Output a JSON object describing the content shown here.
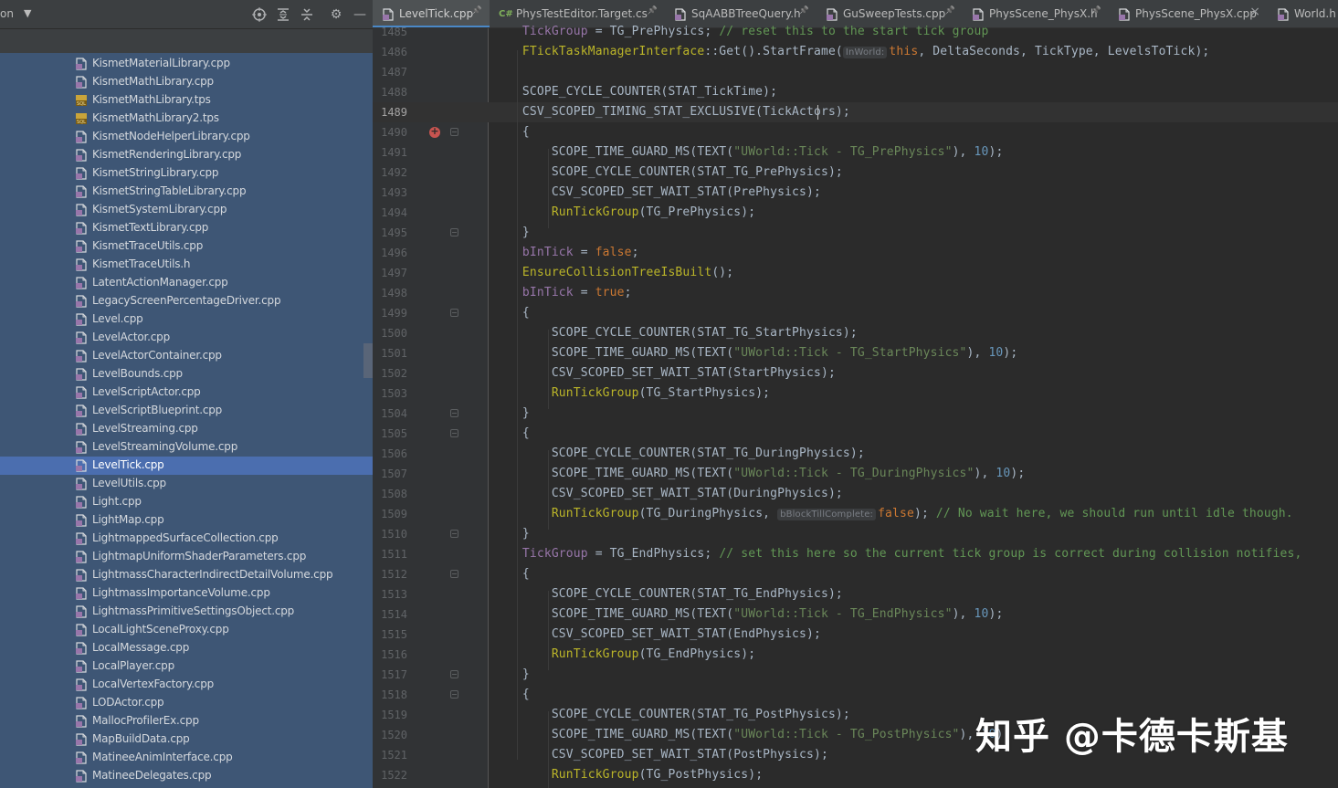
{
  "project_panel": {
    "title": "on",
    "dropdown_icon": "triangle-down-icon",
    "toolbar_icons": [
      "locate-icon",
      "expand-all-icon",
      "collapse-all-icon",
      "gear-icon",
      "minimize-icon"
    ],
    "files": [
      {
        "name": "KismetMaterialLibrary.cpp",
        "icon": "cpp-file-icon"
      },
      {
        "name": "KismetMathLibrary.cpp",
        "icon": "cpp-file-icon"
      },
      {
        "name": "KismetMathLibrary.tps",
        "icon": "sql-file-icon"
      },
      {
        "name": "KismetMathLibrary2.tps",
        "icon": "sql-file-icon"
      },
      {
        "name": "KismetNodeHelperLibrary.cpp",
        "icon": "cpp-file-icon"
      },
      {
        "name": "KismetRenderingLibrary.cpp",
        "icon": "cpp-file-icon"
      },
      {
        "name": "KismetStringLibrary.cpp",
        "icon": "cpp-file-icon"
      },
      {
        "name": "KismetStringTableLibrary.cpp",
        "icon": "cpp-file-icon"
      },
      {
        "name": "KismetSystemLibrary.cpp",
        "icon": "cpp-file-icon"
      },
      {
        "name": "KismetTextLibrary.cpp",
        "icon": "cpp-file-icon"
      },
      {
        "name": "KismetTraceUtils.cpp",
        "icon": "cpp-file-icon"
      },
      {
        "name": "KismetTraceUtils.h",
        "icon": "h-file-icon"
      },
      {
        "name": "LatentActionManager.cpp",
        "icon": "cpp-file-icon"
      },
      {
        "name": "LegacyScreenPercentageDriver.cpp",
        "icon": "cpp-file-icon"
      },
      {
        "name": "Level.cpp",
        "icon": "cpp-file-icon"
      },
      {
        "name": "LevelActor.cpp",
        "icon": "cpp-file-icon"
      },
      {
        "name": "LevelActorContainer.cpp",
        "icon": "cpp-file-icon"
      },
      {
        "name": "LevelBounds.cpp",
        "icon": "cpp-file-icon"
      },
      {
        "name": "LevelScriptActor.cpp",
        "icon": "cpp-file-icon"
      },
      {
        "name": "LevelScriptBlueprint.cpp",
        "icon": "cpp-file-icon"
      },
      {
        "name": "LevelStreaming.cpp",
        "icon": "cpp-file-icon"
      },
      {
        "name": "LevelStreamingVolume.cpp",
        "icon": "cpp-file-icon"
      },
      {
        "name": "LevelTick.cpp",
        "icon": "cpp-file-icon",
        "selected": true
      },
      {
        "name": "LevelUtils.cpp",
        "icon": "cpp-file-icon"
      },
      {
        "name": "Light.cpp",
        "icon": "cpp-file-icon"
      },
      {
        "name": "LightMap.cpp",
        "icon": "cpp-file-icon"
      },
      {
        "name": "LightmappedSurfaceCollection.cpp",
        "icon": "cpp-file-icon"
      },
      {
        "name": "LightmapUniformShaderParameters.cpp",
        "icon": "cpp-file-icon"
      },
      {
        "name": "LightmassCharacterIndirectDetailVolume.cpp",
        "icon": "cpp-file-icon"
      },
      {
        "name": "LightmassImportanceVolume.cpp",
        "icon": "cpp-file-icon"
      },
      {
        "name": "LightmassPrimitiveSettingsObject.cpp",
        "icon": "cpp-file-icon"
      },
      {
        "name": "LocalLightSceneProxy.cpp",
        "icon": "cpp-file-icon"
      },
      {
        "name": "LocalMessage.cpp",
        "icon": "cpp-file-icon"
      },
      {
        "name": "LocalPlayer.cpp",
        "icon": "cpp-file-icon"
      },
      {
        "name": "LocalVertexFactory.cpp",
        "icon": "cpp-file-icon"
      },
      {
        "name": "LODActor.cpp",
        "icon": "cpp-file-icon"
      },
      {
        "name": "MallocProfilerEx.cpp",
        "icon": "cpp-file-icon"
      },
      {
        "name": "MapBuildData.cpp",
        "icon": "cpp-file-icon"
      },
      {
        "name": "MatineeAnimInterface.cpp",
        "icon": "cpp-file-icon"
      },
      {
        "name": "MatineeDelegates.cpp",
        "icon": "cpp-file-icon"
      }
    ]
  },
  "tabs": [
    {
      "label": "LevelTick.cpp",
      "icon": "cpp-file-icon",
      "active": true,
      "pin": "pin-icon"
    },
    {
      "label": "PhysTestEditor.Target.cs",
      "icon": "csharp-file-icon",
      "icon_text": "C#",
      "pin": "pin-icon"
    },
    {
      "label": "SqAABBTreeQuery.h",
      "icon": "h-file-icon",
      "pin": "pin-icon"
    },
    {
      "label": "GuSweepTests.cpp",
      "icon": "cpp-file-icon",
      "pin": "pin-icon"
    },
    {
      "label": "PhysScene_PhysX.h",
      "icon": "h-file-icon",
      "pin": "pin-icon"
    },
    {
      "label": "PhysScene_PhysX.cpp",
      "icon": "cpp-file-icon",
      "close": "×"
    },
    {
      "label": "World.h",
      "icon": "h-file-icon"
    }
  ],
  "editor": {
    "current_line": 1489,
    "breakpoint_line": 1490,
    "lines": [
      {
        "no": "1485",
        "tokens": [
          [
            "",
            "    "
          ],
          [
            "field",
            "TickGroup"
          ],
          [
            "plain",
            " = TG_PrePhysics; "
          ],
          [
            "comment",
            "// reset this to the start tick group"
          ]
        ]
      },
      {
        "no": "1486",
        "tokens": [
          [
            "",
            "    "
          ],
          [
            "macro",
            "FTickTaskManagerInterface"
          ],
          [
            "plain",
            "::Get().StartFrame("
          ],
          [
            "hint",
            "InWorld:"
          ],
          [
            "kw",
            "this"
          ],
          [
            "plain",
            ", DeltaSeconds, TickType, LevelsToTick);"
          ]
        ]
      },
      {
        "no": "1487",
        "tokens": []
      },
      {
        "no": "1488",
        "tokens": [
          [
            "",
            "    "
          ],
          [
            "plain",
            "SCOPE_CYCLE_COUNTER(STAT_TickTime);"
          ]
        ]
      },
      {
        "no": "1489",
        "tokens": [
          [
            "",
            "    "
          ],
          [
            "plain",
            "CSV_SCOPED_TIMING_STAT_EXCLUSIVE(TickActors);"
          ]
        ]
      },
      {
        "no": "1490",
        "tokens": [
          [
            "",
            "    "
          ],
          [
            "plain",
            "{"
          ]
        ]
      },
      {
        "no": "1491",
        "tokens": [
          [
            "",
            "        "
          ],
          [
            "plain",
            "SCOPE_TIME_GUARD_MS(TEXT("
          ],
          [
            "str",
            "\"UWorld::Tick - TG_PrePhysics\""
          ],
          [
            "plain",
            "), "
          ],
          [
            "num",
            "10"
          ],
          [
            "plain",
            ");"
          ]
        ]
      },
      {
        "no": "1492",
        "tokens": [
          [
            "",
            "        "
          ],
          [
            "plain",
            "SCOPE_CYCLE_COUNTER(STAT_TG_PrePhysics);"
          ]
        ]
      },
      {
        "no": "1493",
        "tokens": [
          [
            "",
            "        "
          ],
          [
            "plain",
            "CSV_SCOPED_SET_WAIT_STAT(PrePhysics);"
          ]
        ]
      },
      {
        "no": "1494",
        "tokens": [
          [
            "",
            "        "
          ],
          [
            "macro",
            "RunTickGroup"
          ],
          [
            "plain",
            "(TG_PrePhysics);"
          ]
        ]
      },
      {
        "no": "1495",
        "tokens": [
          [
            "",
            "    "
          ],
          [
            "plain",
            "}"
          ]
        ]
      },
      {
        "no": "1496",
        "tokens": [
          [
            "",
            "    "
          ],
          [
            "field",
            "bInTick"
          ],
          [
            "plain",
            " = "
          ],
          [
            "kw",
            "false"
          ],
          [
            "plain",
            ";"
          ]
        ]
      },
      {
        "no": "1497",
        "tokens": [
          [
            "",
            "    "
          ],
          [
            "macro",
            "EnsureCollisionTreeIsBuilt"
          ],
          [
            "plain",
            "();"
          ]
        ]
      },
      {
        "no": "1498",
        "tokens": [
          [
            "",
            "    "
          ],
          [
            "field",
            "bInTick"
          ],
          [
            "plain",
            " = "
          ],
          [
            "kw",
            "true"
          ],
          [
            "plain",
            ";"
          ]
        ]
      },
      {
        "no": "1499",
        "tokens": [
          [
            "",
            "    "
          ],
          [
            "plain",
            "{"
          ]
        ]
      },
      {
        "no": "1500",
        "tokens": [
          [
            "",
            "        "
          ],
          [
            "plain",
            "SCOPE_CYCLE_COUNTER(STAT_TG_StartPhysics);"
          ]
        ]
      },
      {
        "no": "1501",
        "tokens": [
          [
            "",
            "        "
          ],
          [
            "plain",
            "SCOPE_TIME_GUARD_MS(TEXT("
          ],
          [
            "str",
            "\"UWorld::Tick - TG_StartPhysics\""
          ],
          [
            "plain",
            "), "
          ],
          [
            "num",
            "10"
          ],
          [
            "plain",
            ");"
          ]
        ]
      },
      {
        "no": "1502",
        "tokens": [
          [
            "",
            "        "
          ],
          [
            "plain",
            "CSV_SCOPED_SET_WAIT_STAT(StartPhysics);"
          ]
        ]
      },
      {
        "no": "1503",
        "tokens": [
          [
            "",
            "        "
          ],
          [
            "macro",
            "RunTickGroup"
          ],
          [
            "plain",
            "(TG_StartPhysics);"
          ]
        ]
      },
      {
        "no": "1504",
        "tokens": [
          [
            "",
            "    "
          ],
          [
            "plain",
            "}"
          ]
        ]
      },
      {
        "no": "1505",
        "tokens": [
          [
            "",
            "    "
          ],
          [
            "plain",
            "{"
          ]
        ]
      },
      {
        "no": "1506",
        "tokens": [
          [
            "",
            "        "
          ],
          [
            "plain",
            "SCOPE_CYCLE_COUNTER(STAT_TG_DuringPhysics);"
          ]
        ]
      },
      {
        "no": "1507",
        "tokens": [
          [
            "",
            "        "
          ],
          [
            "plain",
            "SCOPE_TIME_GUARD_MS(TEXT("
          ],
          [
            "str",
            "\"UWorld::Tick - TG_DuringPhysics\""
          ],
          [
            "plain",
            "), "
          ],
          [
            "num",
            "10"
          ],
          [
            "plain",
            ");"
          ]
        ]
      },
      {
        "no": "1508",
        "tokens": [
          [
            "",
            "        "
          ],
          [
            "plain",
            "CSV_SCOPED_SET_WAIT_STAT(DuringPhysics);"
          ]
        ]
      },
      {
        "no": "1509",
        "tokens": [
          [
            "",
            "        "
          ],
          [
            "macro",
            "RunTickGroup"
          ],
          [
            "plain",
            "(TG_DuringPhysics, "
          ],
          [
            "hint",
            "bBlockTillComplete:"
          ],
          [
            "kw",
            "false"
          ],
          [
            "plain",
            "); "
          ],
          [
            "comment",
            "// No wait here, we should run until idle though."
          ]
        ]
      },
      {
        "no": "1510",
        "tokens": [
          [
            "",
            "    "
          ],
          [
            "plain",
            "}"
          ]
        ]
      },
      {
        "no": "1511",
        "tokens": [
          [
            "",
            "    "
          ],
          [
            "field",
            "TickGroup"
          ],
          [
            "plain",
            " = TG_EndPhysics; "
          ],
          [
            "comment",
            "// set this here so the current tick group is correct during collision notifies,"
          ]
        ]
      },
      {
        "no": "1512",
        "tokens": [
          [
            "",
            "    "
          ],
          [
            "plain",
            "{"
          ]
        ]
      },
      {
        "no": "1513",
        "tokens": [
          [
            "",
            "        "
          ],
          [
            "plain",
            "SCOPE_CYCLE_COUNTER(STAT_TG_EndPhysics);"
          ]
        ]
      },
      {
        "no": "1514",
        "tokens": [
          [
            "",
            "        "
          ],
          [
            "plain",
            "SCOPE_TIME_GUARD_MS(TEXT("
          ],
          [
            "str",
            "\"UWorld::Tick - TG_EndPhysics\""
          ],
          [
            "plain",
            "), "
          ],
          [
            "num",
            "10"
          ],
          [
            "plain",
            ");"
          ]
        ]
      },
      {
        "no": "1515",
        "tokens": [
          [
            "",
            "        "
          ],
          [
            "plain",
            "CSV_SCOPED_SET_WAIT_STAT(EndPhysics);"
          ]
        ]
      },
      {
        "no": "1516",
        "tokens": [
          [
            "",
            "        "
          ],
          [
            "macro",
            "RunTickGroup"
          ],
          [
            "plain",
            "(TG_EndPhysics);"
          ]
        ]
      },
      {
        "no": "1517",
        "tokens": [
          [
            "",
            "    "
          ],
          [
            "plain",
            "}"
          ]
        ]
      },
      {
        "no": "1518",
        "tokens": [
          [
            "",
            "    "
          ],
          [
            "plain",
            "{"
          ]
        ]
      },
      {
        "no": "1519",
        "tokens": [
          [
            "",
            "        "
          ],
          [
            "plain",
            "SCOPE_CYCLE_COUNTER(STAT_TG_PostPhysics);"
          ]
        ]
      },
      {
        "no": "1520",
        "tokens": [
          [
            "",
            "        "
          ],
          [
            "plain",
            "SCOPE_TIME_GUARD_MS(TEXT("
          ],
          [
            "str",
            "\"UWorld::Tick - TG_PostPhysics\""
          ],
          [
            "plain",
            "), "
          ],
          [
            "num",
            "10"
          ],
          [
            "plain",
            ");"
          ]
        ]
      },
      {
        "no": "1521",
        "tokens": [
          [
            "",
            "        "
          ],
          [
            "plain",
            "CSV_SCOPED_SET_WAIT_STAT(PostPhysics);"
          ]
        ]
      },
      {
        "no": "1522",
        "tokens": [
          [
            "",
            "        "
          ],
          [
            "macro",
            "RunTickGroup"
          ],
          [
            "plain",
            "(TG_PostPhysics);"
          ]
        ]
      }
    ]
  },
  "watermark": {
    "text": "知乎 @卡德卡斯基"
  },
  "colors": {
    "editor_bg": "#2b2b2b",
    "gutter_bg": "#313335",
    "panel_bg": "#3c3f41",
    "file_list_bg": "#3e5675",
    "selection": "#4b6eaf",
    "keyword": "#cc7832",
    "string": "#6a8759",
    "number": "#6897bb",
    "field": "#9876aa",
    "function": "#bbb529",
    "comment": "#629755"
  }
}
